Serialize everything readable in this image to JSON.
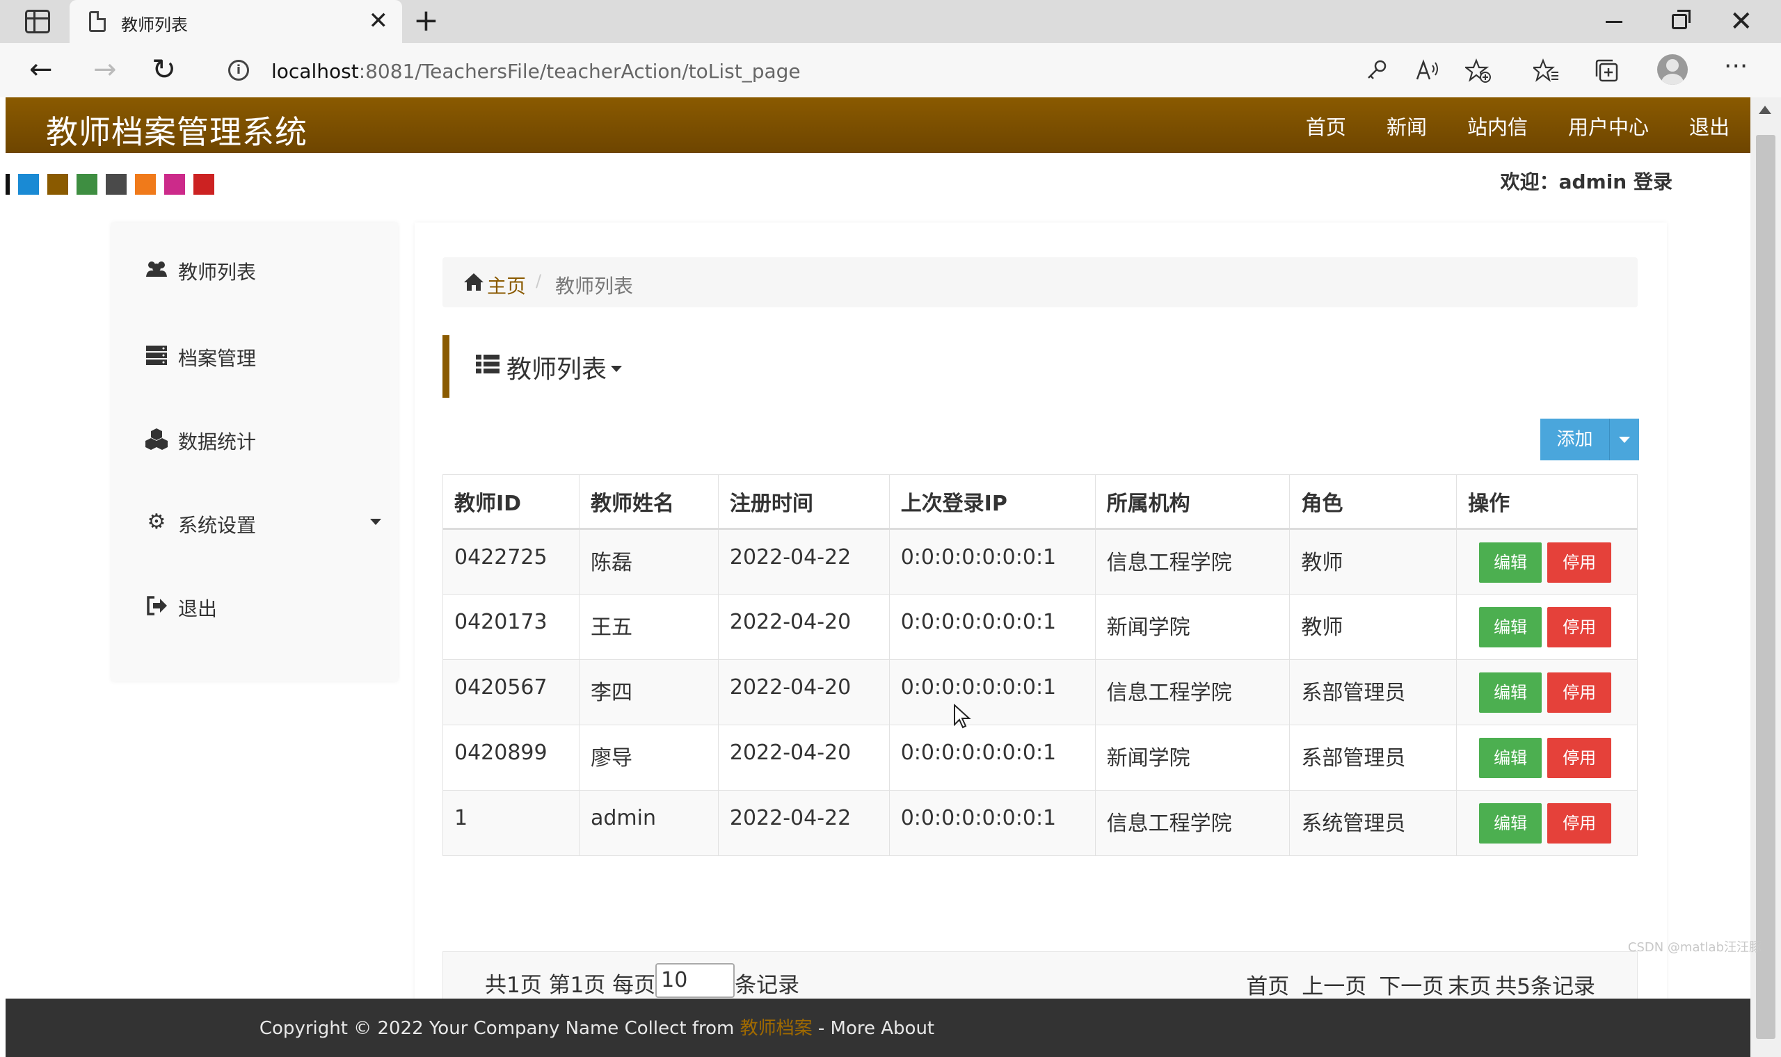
{
  "browser": {
    "tab_title": "教师列表",
    "tab_close": "✕",
    "new_tab": "+",
    "url_host": "localhost",
    "url_rest": ":8081/TeachersFile/teacherAction/toList_page",
    "close": "✕"
  },
  "site": {
    "title": "教师档案管理系统",
    "nav": [
      "首页",
      "新闻",
      "站内信",
      "用户中心",
      "退出"
    ],
    "welcome": "欢迎：admin 登录",
    "theme_colors": [
      "#111111",
      "#1a8ad4",
      "#8a5a00",
      "#3e8e41",
      "#4a4a4a",
      "#f07a1a",
      "#cc2a8a",
      "#cc2222"
    ]
  },
  "sidebar": {
    "items": [
      {
        "label": "教师列表",
        "icon": "users-icon"
      },
      {
        "label": "档案管理",
        "icon": "server-icon"
      },
      {
        "label": "数据统计",
        "icon": "cubes-icon"
      },
      {
        "label": "系统设置",
        "icon": "gear-icon"
      },
      {
        "label": "退出",
        "icon": "sign-out-icon"
      }
    ]
  },
  "breadcrumb": {
    "home": "主页",
    "separator": "/",
    "current": "教师列表"
  },
  "section": {
    "title": "教师列表"
  },
  "add_button": "添加",
  "table": {
    "headers": [
      "教师ID",
      "教师姓名",
      "注册时间",
      "上次登录IP",
      "所属机构",
      "角色",
      "操作"
    ],
    "rows": [
      [
        "0422725",
        "陈磊",
        "2022-04-22",
        "0:0:0:0:0:0:0:1",
        "信息工程学院",
        "教师"
      ],
      [
        "0420173",
        "王五",
        "2022-04-20",
        "0:0:0:0:0:0:0:1",
        "新闻学院",
        "教师"
      ],
      [
        "0420567",
        "李四",
        "2022-04-20",
        "0:0:0:0:0:0:0:1",
        "信息工程学院",
        "系部管理员"
      ],
      [
        "0420899",
        "廖导",
        "2022-04-20",
        "0:0:0:0:0:0:0:1",
        "新闻学院",
        "系部管理员"
      ],
      [
        "1",
        "admin",
        "2022-04-22",
        "0:0:0:0:0:0:0:1",
        "信息工程学院",
        "系统管理员"
      ]
    ],
    "edit_label": "编辑",
    "disable_label": "停用"
  },
  "pager": {
    "summary_prefix": "共1页 第1页 每页",
    "page_size": "10",
    "summary_suffix": "条记录",
    "first": "首页",
    "prev": "上一页",
    "next": "下一页",
    "last": "末页",
    "total": "共5条记录"
  },
  "footer": {
    "prefix": "Copyright © 2022 Your Company Name Collect from ",
    "brand": "教师档案",
    "suffix": " - More About"
  },
  "watermark": "CSDN @matlab汪汪豚",
  "colors": {
    "header_brown": "#8a5a00",
    "add_blue": "#4aa6dc",
    "edit_green": "#4caf50",
    "disable_red": "#e5413a"
  }
}
